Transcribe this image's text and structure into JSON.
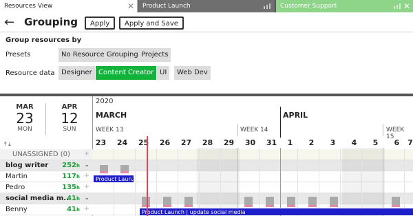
{
  "tabs": [
    {
      "label": "Resources View"
    },
    {
      "label": "Product Launch"
    },
    {
      "label": "Customer Support"
    }
  ],
  "header": {
    "title": "Grouping",
    "apply_label": "Apply",
    "apply_save_label": "Apply and Save"
  },
  "grouping": {
    "title": "Group resources by",
    "presets_label": "Presets",
    "presets": [
      "No Resource Grouping",
      "Projects"
    ],
    "resource_data_label": "Resource data",
    "resource_data": [
      "Designer",
      "Content Creator",
      "UI",
      "Web Dev"
    ],
    "selected": "Content Creator"
  },
  "dates": {
    "start": {
      "month": "MAR",
      "day": "23",
      "weekday": "MON"
    },
    "end": {
      "month": "APR",
      "day": "12",
      "weekday": "SUN"
    }
  },
  "timeline": {
    "year": "2020",
    "months": [
      "MARCH",
      "APRIL"
    ],
    "weeks": [
      "WEEK 13",
      "WEEK 14",
      "WEEK 15"
    ],
    "days": [
      "23",
      "24",
      "25",
      "26",
      "27",
      "28",
      "29",
      "30",
      "31",
      "1",
      "2",
      "3",
      "4",
      "5",
      "6",
      "7"
    ]
  },
  "rows": [
    {
      "name": "UNASSIGNED (0)",
      "hours": "",
      "type": "unassigned"
    },
    {
      "name": "blog writer",
      "hours": "252",
      "type": "group"
    },
    {
      "name": "Martin",
      "hours": "117",
      "type": "person"
    },
    {
      "name": "Pedro",
      "hours": "135",
      "type": "person"
    },
    {
      "name": "social media m...",
      "hours": "41",
      "type": "group"
    },
    {
      "name": "Benny",
      "hours": "41",
      "type": "person"
    }
  ],
  "hours_unit": "h",
  "tasks": [
    {
      "label": "Product Laun..."
    },
    {
      "label": "Product Launch | update social media"
    }
  ],
  "colors": {
    "accent_green": "#12b33a",
    "task_blue": "#1d1ec9",
    "today_red": "#e0425a",
    "tab_green": "#8ed58a"
  }
}
